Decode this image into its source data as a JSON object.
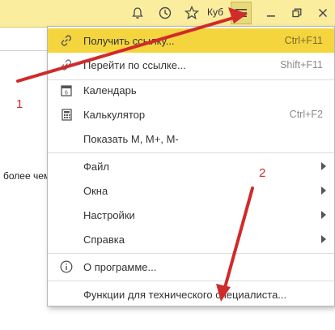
{
  "titlebar": {
    "user_label": "Куб"
  },
  "background": {
    "left_text": "более чем"
  },
  "menu": {
    "items": [
      {
        "label": "Получить ссылку...",
        "shortcut": "Ctrl+F11"
      },
      {
        "label": "Перейти по ссылке...",
        "shortcut": "Shift+F11"
      },
      {
        "label": "Календарь",
        "shortcut": ""
      },
      {
        "label": "Калькулятор",
        "shortcut": "Ctrl+F2"
      },
      {
        "label": "Показать М, М+, М-",
        "shortcut": ""
      },
      {
        "label": "Файл",
        "shortcut": ""
      },
      {
        "label": "Окна",
        "shortcut": ""
      },
      {
        "label": "Настройки",
        "shortcut": ""
      },
      {
        "label": "Справка",
        "shortcut": ""
      },
      {
        "label": "О программе...",
        "shortcut": ""
      },
      {
        "label": "Функции для технического специалиста...",
        "shortcut": ""
      }
    ]
  },
  "annotations": {
    "label_1": "1",
    "label_2": "2"
  },
  "colors": {
    "titlebar_bg": "#fbed9e",
    "highlight": "#f5d53e",
    "annotation_red": "#d02a2a"
  }
}
